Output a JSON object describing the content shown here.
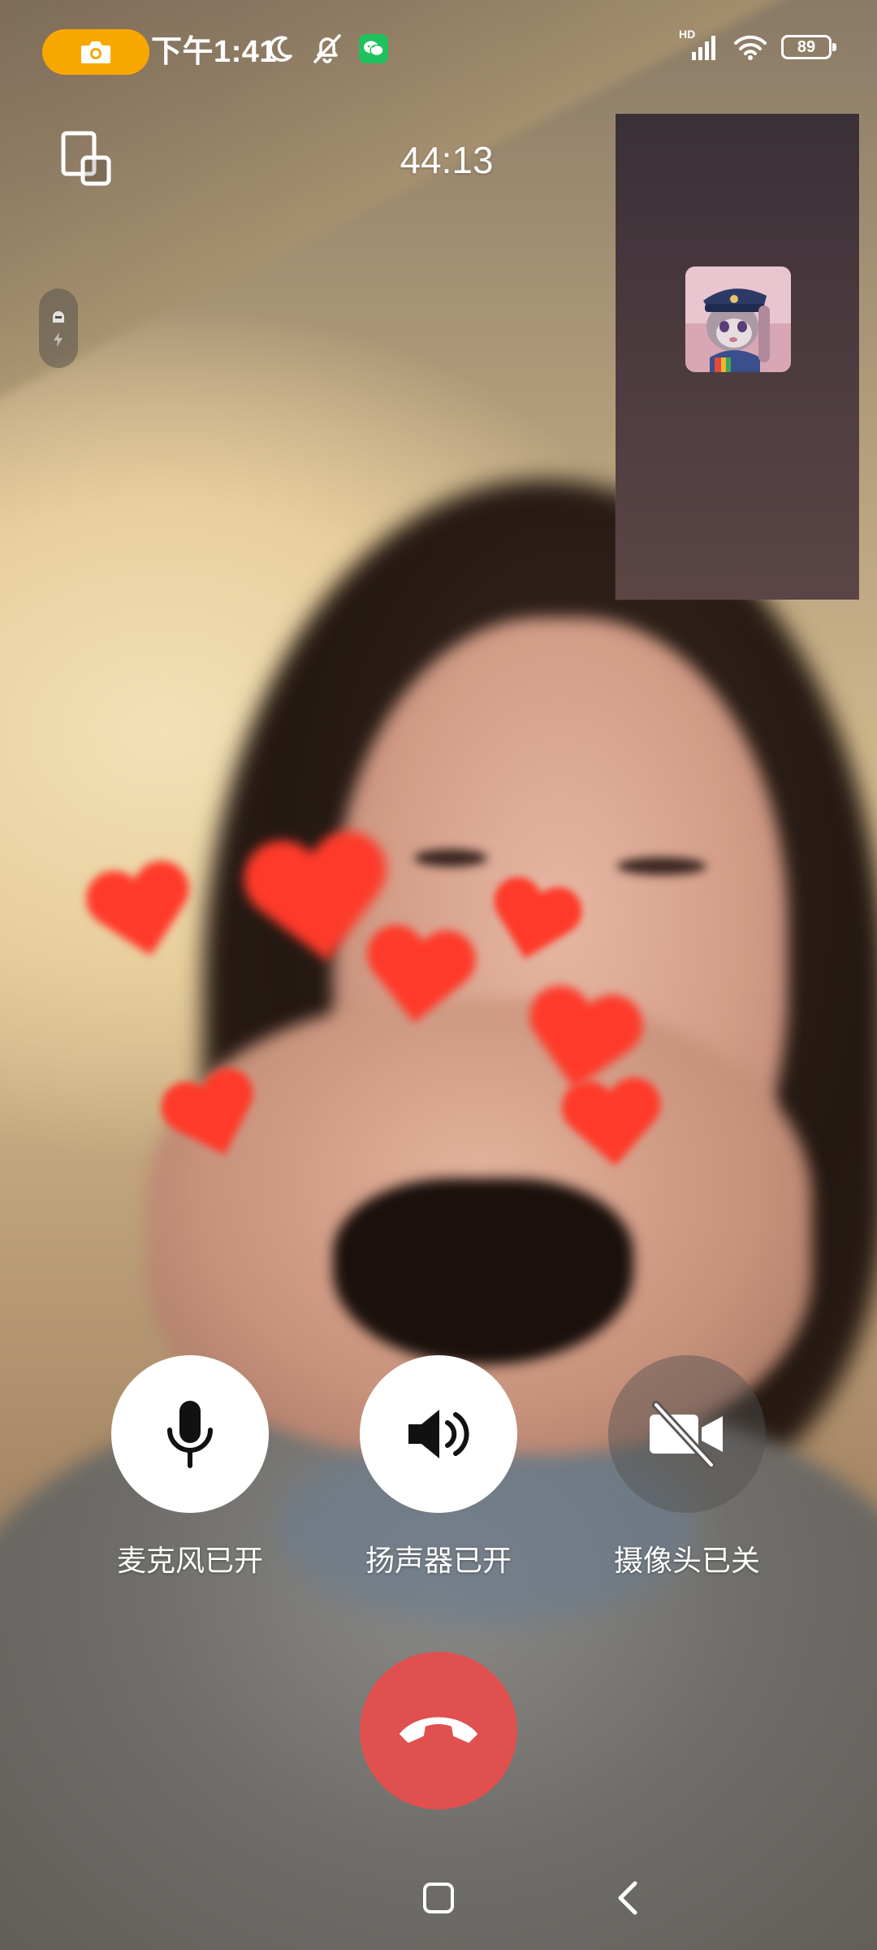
{
  "status_bar": {
    "time": "下午1:41",
    "network": "HD",
    "battery": "89",
    "icons": [
      "screen-record-icon",
      "moon-icon",
      "bell-off-icon",
      "wechat-icon",
      "signal-icon",
      "wifi-icon",
      "battery-icon"
    ]
  },
  "call": {
    "timer": "44:13",
    "remote_video": "camera-feed"
  },
  "controls": {
    "mic_label": "麦克风已开",
    "speaker_label": "扬声器已开",
    "camera_label": "摄像头已关",
    "mic_on": true,
    "speaker_on": true,
    "camera_on": false
  },
  "colors": {
    "hangup": "#e0504f",
    "record_pill": "#f7a800",
    "wechat": "#1fc15c"
  },
  "nav": {
    "icons": [
      "home-square-icon",
      "back-chevron-icon"
    ]
  }
}
